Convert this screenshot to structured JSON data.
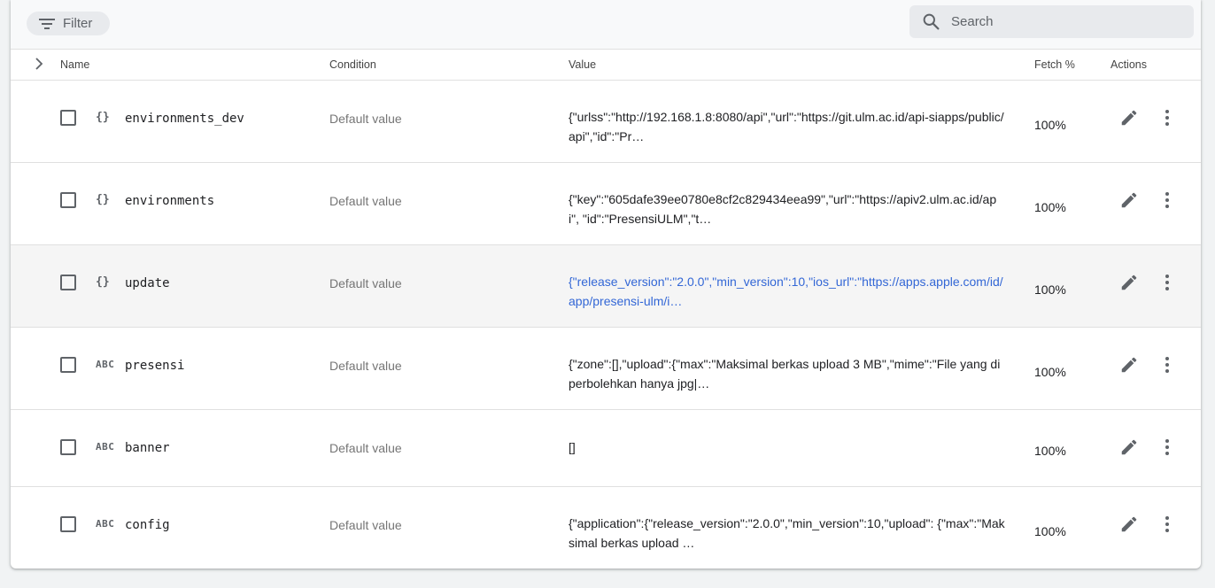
{
  "toolbar": {
    "filter_label": "Filter",
    "search_placeholder": "Search"
  },
  "table": {
    "columns": {
      "name": "Name",
      "condition": "Condition",
      "value": "Value",
      "fetch": "Fetch %",
      "actions": "Actions"
    },
    "rows": [
      {
        "type_icon": "{}",
        "name": "environments_dev",
        "condition": "Default value",
        "value": "{\"urlss\":\"http://192.168.1.8:8080/api\",\"url\":\"https://git.ulm.ac.id/api-siapps/public/api\",\"id\":\"Pr…",
        "fetch": "100%"
      },
      {
        "type_icon": "{}",
        "name": "environments",
        "condition": "Default value",
        "value": "{\"key\":\"605dafe39ee0780e8cf2c829434eea99\",\"url\":\"https://apiv2.ulm.ac.id/api\", \"id\":\"PresensiULM\",\"t…",
        "fetch": "100%"
      },
      {
        "type_icon": "{}",
        "name": "update",
        "condition": "Default value",
        "value": "{\"release_version\":\"2.0.0\",\"min_version\":10,\"ios_url\":\"https://apps.apple.com/id/app/presensi-ulm/i…",
        "fetch": "100%"
      },
      {
        "type_icon": "ABC",
        "name": "presensi",
        "condition": "Default value",
        "value": "{\"zone\":[],\"upload\":{\"max\":\"Maksimal berkas upload 3 MB\",\"mime\":\"File yang diperbolehkan hanya jpg|…",
        "fetch": "100%"
      },
      {
        "type_icon": "ABC",
        "name": "banner",
        "condition": "Default value",
        "value": "[]",
        "fetch": "100%"
      },
      {
        "type_icon": "ABC",
        "name": "config",
        "condition": "Default value",
        "value": "{\"application\":{\"release_version\":\"2.0.0\",\"min_version\":10,\"upload\": {\"max\":\"Maksimal berkas upload …",
        "fetch": "100%"
      }
    ]
  },
  "icons": {
    "filter": "filter-list-icon",
    "search": "search-icon",
    "expand": "chevron-right-icon",
    "edit": "pencil-icon",
    "more": "more-vert-icon"
  },
  "colors": {
    "link": "#3367d6",
    "icon": "#5f6368",
    "row_highlight": "#f5f5f5"
  }
}
